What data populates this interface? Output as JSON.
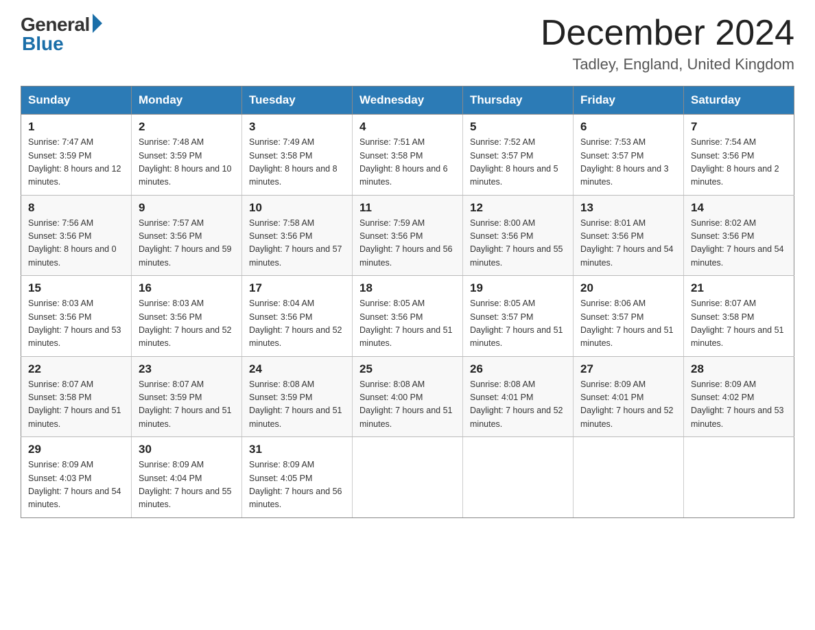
{
  "header": {
    "logo_general": "General",
    "logo_blue": "Blue",
    "title": "December 2024",
    "location": "Tadley, England, United Kingdom"
  },
  "calendar": {
    "days_of_week": [
      "Sunday",
      "Monday",
      "Tuesday",
      "Wednesday",
      "Thursday",
      "Friday",
      "Saturday"
    ],
    "weeks": [
      [
        {
          "day": "1",
          "sunrise": "7:47 AM",
          "sunset": "3:59 PM",
          "daylight": "8 hours and 12 minutes."
        },
        {
          "day": "2",
          "sunrise": "7:48 AM",
          "sunset": "3:59 PM",
          "daylight": "8 hours and 10 minutes."
        },
        {
          "day": "3",
          "sunrise": "7:49 AM",
          "sunset": "3:58 PM",
          "daylight": "8 hours and 8 minutes."
        },
        {
          "day": "4",
          "sunrise": "7:51 AM",
          "sunset": "3:58 PM",
          "daylight": "8 hours and 6 minutes."
        },
        {
          "day": "5",
          "sunrise": "7:52 AM",
          "sunset": "3:57 PM",
          "daylight": "8 hours and 5 minutes."
        },
        {
          "day": "6",
          "sunrise": "7:53 AM",
          "sunset": "3:57 PM",
          "daylight": "8 hours and 3 minutes."
        },
        {
          "day": "7",
          "sunrise": "7:54 AM",
          "sunset": "3:56 PM",
          "daylight": "8 hours and 2 minutes."
        }
      ],
      [
        {
          "day": "8",
          "sunrise": "7:56 AM",
          "sunset": "3:56 PM",
          "daylight": "8 hours and 0 minutes."
        },
        {
          "day": "9",
          "sunrise": "7:57 AM",
          "sunset": "3:56 PM",
          "daylight": "7 hours and 59 minutes."
        },
        {
          "day": "10",
          "sunrise": "7:58 AM",
          "sunset": "3:56 PM",
          "daylight": "7 hours and 57 minutes."
        },
        {
          "day": "11",
          "sunrise": "7:59 AM",
          "sunset": "3:56 PM",
          "daylight": "7 hours and 56 minutes."
        },
        {
          "day": "12",
          "sunrise": "8:00 AM",
          "sunset": "3:56 PM",
          "daylight": "7 hours and 55 minutes."
        },
        {
          "day": "13",
          "sunrise": "8:01 AM",
          "sunset": "3:56 PM",
          "daylight": "7 hours and 54 minutes."
        },
        {
          "day": "14",
          "sunrise": "8:02 AM",
          "sunset": "3:56 PM",
          "daylight": "7 hours and 54 minutes."
        }
      ],
      [
        {
          "day": "15",
          "sunrise": "8:03 AM",
          "sunset": "3:56 PM",
          "daylight": "7 hours and 53 minutes."
        },
        {
          "day": "16",
          "sunrise": "8:03 AM",
          "sunset": "3:56 PM",
          "daylight": "7 hours and 52 minutes."
        },
        {
          "day": "17",
          "sunrise": "8:04 AM",
          "sunset": "3:56 PM",
          "daylight": "7 hours and 52 minutes."
        },
        {
          "day": "18",
          "sunrise": "8:05 AM",
          "sunset": "3:56 PM",
          "daylight": "7 hours and 51 minutes."
        },
        {
          "day": "19",
          "sunrise": "8:05 AM",
          "sunset": "3:57 PM",
          "daylight": "7 hours and 51 minutes."
        },
        {
          "day": "20",
          "sunrise": "8:06 AM",
          "sunset": "3:57 PM",
          "daylight": "7 hours and 51 minutes."
        },
        {
          "day": "21",
          "sunrise": "8:07 AM",
          "sunset": "3:58 PM",
          "daylight": "7 hours and 51 minutes."
        }
      ],
      [
        {
          "day": "22",
          "sunrise": "8:07 AM",
          "sunset": "3:58 PM",
          "daylight": "7 hours and 51 minutes."
        },
        {
          "day": "23",
          "sunrise": "8:07 AM",
          "sunset": "3:59 PM",
          "daylight": "7 hours and 51 minutes."
        },
        {
          "day": "24",
          "sunrise": "8:08 AM",
          "sunset": "3:59 PM",
          "daylight": "7 hours and 51 minutes."
        },
        {
          "day": "25",
          "sunrise": "8:08 AM",
          "sunset": "4:00 PM",
          "daylight": "7 hours and 51 minutes."
        },
        {
          "day": "26",
          "sunrise": "8:08 AM",
          "sunset": "4:01 PM",
          "daylight": "7 hours and 52 minutes."
        },
        {
          "day": "27",
          "sunrise": "8:09 AM",
          "sunset": "4:01 PM",
          "daylight": "7 hours and 52 minutes."
        },
        {
          "day": "28",
          "sunrise": "8:09 AM",
          "sunset": "4:02 PM",
          "daylight": "7 hours and 53 minutes."
        }
      ],
      [
        {
          "day": "29",
          "sunrise": "8:09 AM",
          "sunset": "4:03 PM",
          "daylight": "7 hours and 54 minutes."
        },
        {
          "day": "30",
          "sunrise": "8:09 AM",
          "sunset": "4:04 PM",
          "daylight": "7 hours and 55 minutes."
        },
        {
          "day": "31",
          "sunrise": "8:09 AM",
          "sunset": "4:05 PM",
          "daylight": "7 hours and 56 minutes."
        },
        null,
        null,
        null,
        null
      ]
    ]
  }
}
